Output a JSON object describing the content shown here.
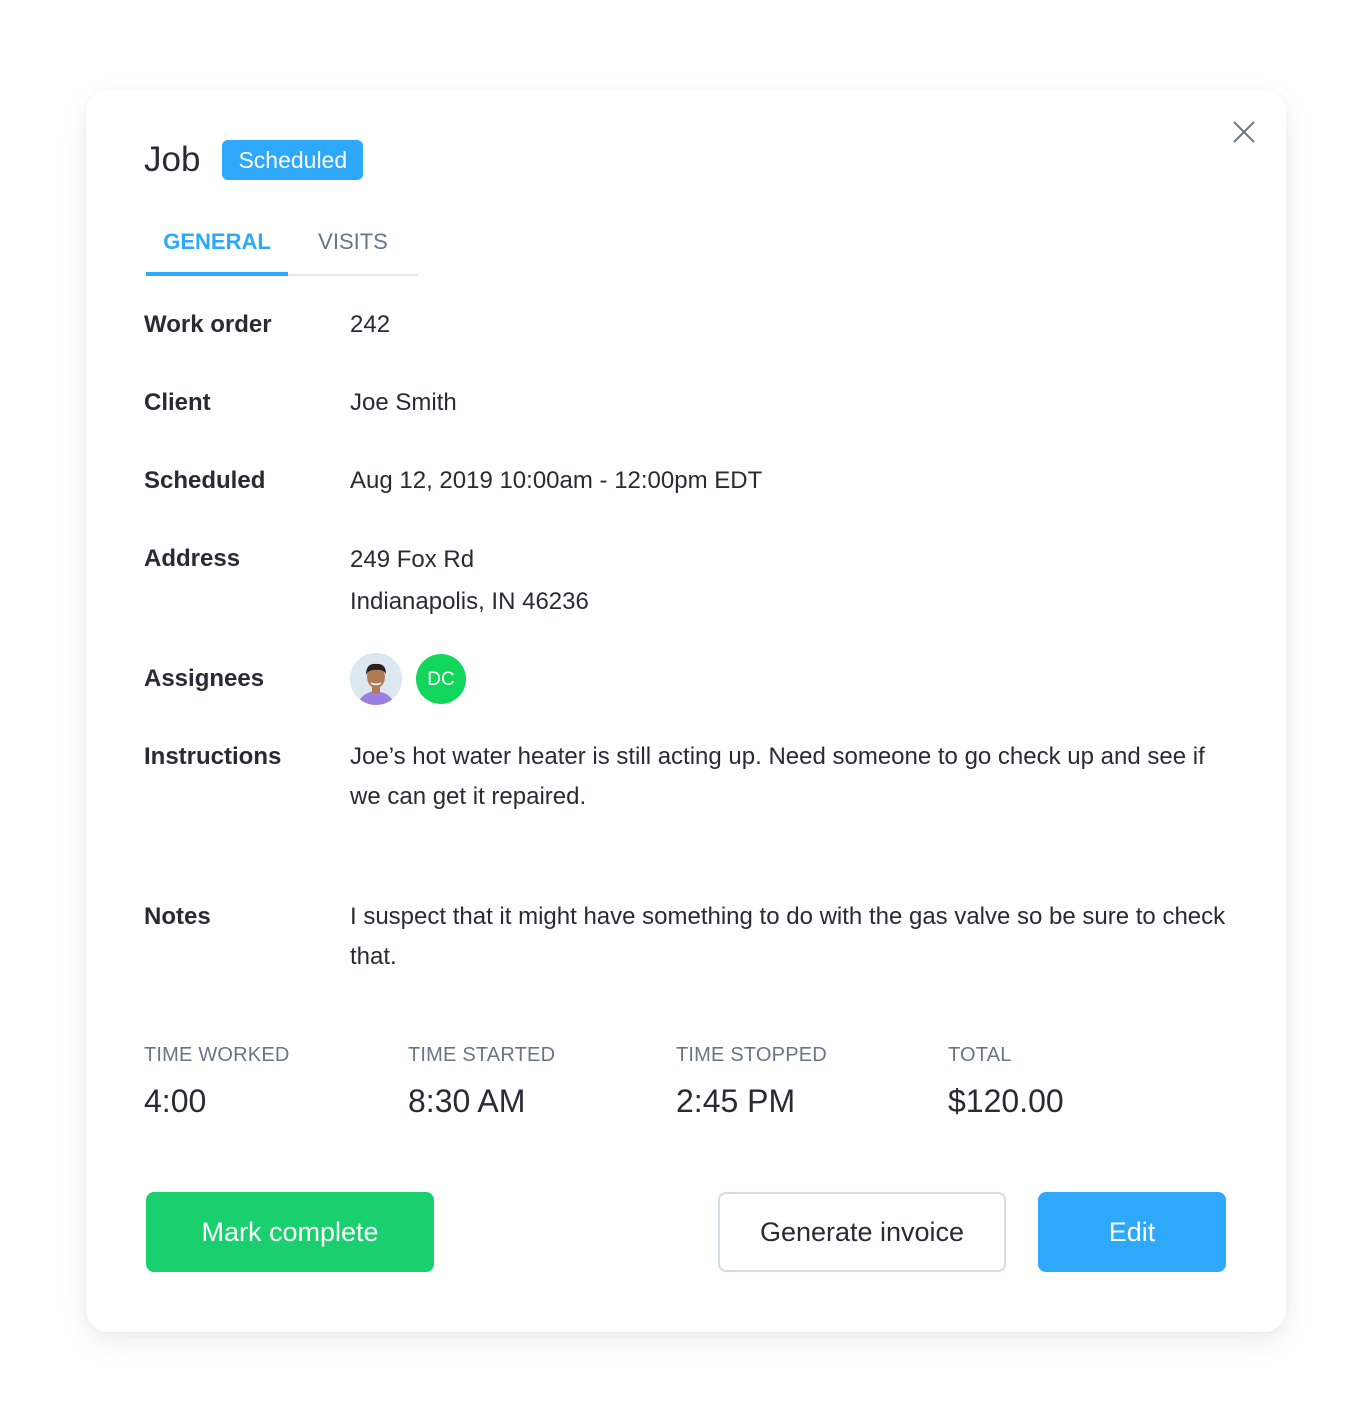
{
  "header": {
    "title": "Job",
    "status_badge": "Scheduled",
    "close_icon": "close-icon"
  },
  "tabs": [
    {
      "label": "GENERAL",
      "active": true
    },
    {
      "label": "VISITS",
      "active": false
    }
  ],
  "fields": {
    "work_order": {
      "label": "Work order",
      "value": "242"
    },
    "client": {
      "label": "Client",
      "value": "Joe Smith"
    },
    "scheduled": {
      "label": "Scheduled",
      "value": "Aug 12, 2019 10:00am - 12:00pm EDT"
    },
    "address": {
      "label": "Address",
      "line1": "249 Fox Rd",
      "line2": "Indianapolis, IN 46236"
    },
    "assignees": {
      "label": "Assignees",
      "people": [
        {
          "type": "photo",
          "icon": "user-photo-avatar"
        },
        {
          "type": "initials",
          "initials": "DC"
        }
      ]
    },
    "instructions": {
      "label": "Instructions",
      "value": "Joe’s hot water heater is still acting up. Need someone to go check up and see if we can get it repaired."
    },
    "notes": {
      "label": "Notes",
      "value": "I suspect that it might have something to do with the gas valve so be sure to check that."
    }
  },
  "stats": {
    "time_worked": {
      "label": "TIME WORKED",
      "value": "4:00"
    },
    "time_started": {
      "label": "TIME STARTED",
      "value": "8:30 AM"
    },
    "time_stopped": {
      "label": "TIME STOPPED",
      "value": "2:45 PM"
    },
    "total": {
      "label": "TOTAL",
      "value": "$120.00"
    }
  },
  "actions": {
    "mark_complete": "Mark complete",
    "generate_invoice": "Generate invoice",
    "edit": "Edit"
  },
  "colors": {
    "primary": "#2ea8fb",
    "success": "#1ad06e",
    "assignee_initials_bg": "#12d65b",
    "muted_text": "#66758a",
    "text": "#272b33"
  }
}
